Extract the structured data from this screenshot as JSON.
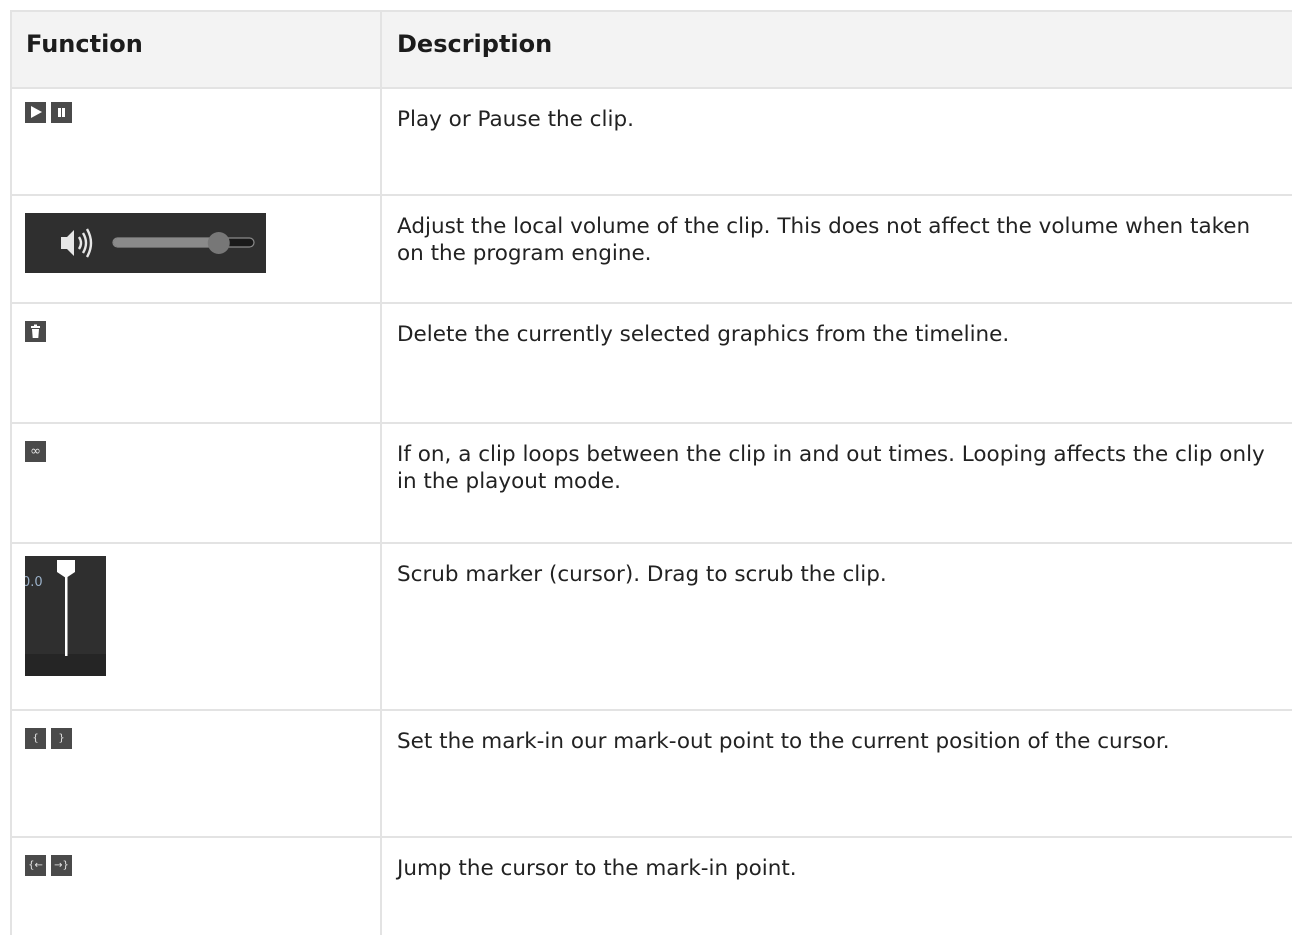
{
  "table": {
    "headers": {
      "function": "Function",
      "description": "Description"
    },
    "rows": [
      {
        "icons": [
          "play-icon",
          "pause-icon"
        ],
        "description": "Play or Pause the clip."
      },
      {
        "icons": [
          "volume-slider-icon"
        ],
        "description": "Adjust the local volume of the clip. This does not affect the volume when taken on the program engine.",
        "volume_level": 0.75
      },
      {
        "icons": [
          "trash-icon"
        ],
        "description": "Delete the currently selected graphics from the timeline."
      },
      {
        "icons": [
          "loop-icon"
        ],
        "description": "If on, a clip loops between the clip in and out times. Looping affects the clip only in the playout mode.",
        "glyph": "∞"
      },
      {
        "icons": [
          "scrub-marker-icon"
        ],
        "description": "Scrub marker (cursor). Drag to scrub the clip.",
        "timecode": "0.0"
      },
      {
        "icons": [
          "mark-in-icon",
          "mark-out-icon"
        ],
        "description": "Set the mark-in our mark-out point to the current position of the cursor.",
        "glyphs": [
          "{",
          "}"
        ]
      },
      {
        "icons": [
          "jump-mark-in-icon",
          "jump-mark-out-icon"
        ],
        "description": "Jump the cursor to the mark-in point.",
        "glyphs": [
          "{←",
          "→}"
        ]
      }
    ]
  },
  "colors": {
    "icon_bg": "#4a4a4a",
    "widget_bg": "#2f2f2f",
    "header_bg": "#f3f3f3",
    "border": "#e3e3e3"
  }
}
